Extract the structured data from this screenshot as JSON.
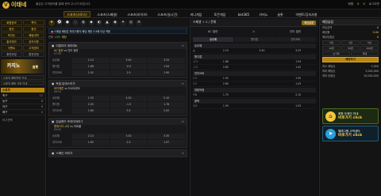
{
  "brand": {
    "logo_mark": "V",
    "logo_text": "이태네"
  },
  "ticker": "출금은 고객센터를 통해 문의 주시기 바랍니다.",
  "userbar": {
    "user": "회원",
    "money": "0",
    "point": "0",
    "logout": "로그아웃"
  },
  "nav": [
    "스포츠(크로스)",
    "스포츠(스페셜)",
    "스포츠(라이브)",
    "스포츠(실시간)",
    "미니게임",
    "토큰게임",
    "bet365",
    "카지노",
    "슬롯",
    "이벤트/공지사항"
  ],
  "left": {
    "buttons": [
      "회원정보",
      "쪽지",
      "충전",
      "환전",
      "포인트",
      "베팅내역",
      "출석체크",
      "공지사항",
      "이벤트",
      "고객센터",
      "충전규정",
      "환전규정"
    ],
    "casino": {
      "title": "카지노",
      "sub": "슬롯"
    },
    "links": [
      "스포츠 베팅방법 안내",
      "스포츠 베팅 규정 안내"
    ],
    "section": "스포츠",
    "sports": [
      {
        "name": "축구",
        "n": "12"
      },
      {
        "name": "농구",
        "n": "8"
      },
      {
        "name": "야구",
        "n": "6"
      },
      {
        "name": "배구",
        "n": "4"
      }
    ],
    "sub": "리그선택"
  },
  "main": {
    "notice": "스페셜 베팅은 최대 5폴더 배당 제한 3.5배 이상 적용",
    "filters": {
      "all": "전체",
      "live": "LIVE",
      "soon": "예정"
    },
    "matches": [
      {
        "league": "이탈리아 세리에A",
        "home": "AC 밀란",
        "away": "인터 밀란",
        "time": "07:45",
        "rows": [
          {
            "k": "승무패",
            "a": "2.15",
            "b": "3.40",
            "c": "3.25"
          },
          {
            "k": "핸디캡",
            "a": "1.88",
            "b": "-0.5",
            "c": "1.94"
          },
          {
            "k": "언더오버",
            "a": "1.92",
            "b": "2.5",
            "c": "1.90"
          }
        ]
      },
      {
        "league": "독일 분데스리가",
        "home": "바이에른",
        "away": "도르트문트",
        "time": "08:30",
        "rows": [
          {
            "k": "승무패",
            "a": "1.55",
            "b": "4.20",
            "c": "5.10"
          },
          {
            "k": "핸디캡",
            "a": "2.05",
            "b": "-1.5",
            "c": "1.78"
          },
          {
            "k": "언더오버",
            "a": "1.80",
            "b": "3.5",
            "c": "2.02"
          }
        ]
      },
      {
        "league": "잉글랜드 프리미어리그",
        "home": "맨체스터 시티",
        "away": "리버풀",
        "time": "09:00",
        "rows": [
          {
            "k": "승무패",
            "a": "2.10",
            "b": "3.50",
            "c": "3.30"
          },
          {
            "k": "언더오버",
            "a": "1.85",
            "b": "2.5",
            "c": "1.97"
          }
        ]
      }
    ],
    "footer_league": "스페인 라리가"
  },
  "center": {
    "title": "스페셜 + 2 / 전체",
    "btn": "배당설정",
    "home": "AC 밀란",
    "away": "인터 밀란",
    "tabs": [
      "승무패",
      "핸디캡",
      "언더오버"
    ],
    "sections": [
      {
        "name": "승무패",
        "rows": [
          {
            "k": "승",
            "a": "2.15",
            "b": "3.40",
            "c": "3.25"
          }
        ]
      },
      {
        "name": "핸디캡",
        "rows": [
          {
            "k": "-0.5",
            "a": "1.88",
            "b": "",
            "c": "1.94"
          },
          {
            "k": "-1.5",
            "a": "2.85",
            "b": "",
            "c": "1.42"
          }
        ]
      },
      {
        "name": "언더오버",
        "rows": [
          {
            "k": "2.5",
            "a": "1.92",
            "b": "",
            "c": "1.90"
          },
          {
            "k": "3.5",
            "a": "2.80",
            "b": "",
            "c": "1.43"
          }
        ]
      },
      {
        "name": "양팀득점",
        "rows": [
          {
            "k": "Y/N",
            "a": "1.70",
            "b": "",
            "c": "2.10"
          }
        ]
      },
      {
        "name": "홀짝",
        "rows": [
          {
            "k": "O/E",
            "a": "1.93",
            "b": "",
            "c": "1.93"
          }
        ]
      }
    ]
  },
  "slip": {
    "title": "베팅슬립",
    "rows": [
      {
        "k": "보유금액",
        "v": "0"
      },
      {
        "k": "배당률",
        "v": "0.00"
      },
      {
        "k": "예상당첨금",
        "v": "0"
      }
    ],
    "amounts": [
      "5천",
      "1만",
      "5만",
      "10만",
      "50만",
      "100만"
    ],
    "reset": "초기화",
    "max": "최대",
    "bet": "베팅하기",
    "limits": [
      {
        "k": "최소 베팅금",
        "v": "5,000"
      },
      {
        "k": "최대 베팅금",
        "v": "3,000,000"
      },
      {
        "k": "최대 당첨금",
        "v": "10,000,000"
      }
    ],
    "promo1": {
      "line1": "회원 도메인 안내",
      "line2": "바로가기 click"
    },
    "promo2": {
      "line1": "텔레그램 고객센터",
      "line2": "바로가기 click"
    }
  }
}
